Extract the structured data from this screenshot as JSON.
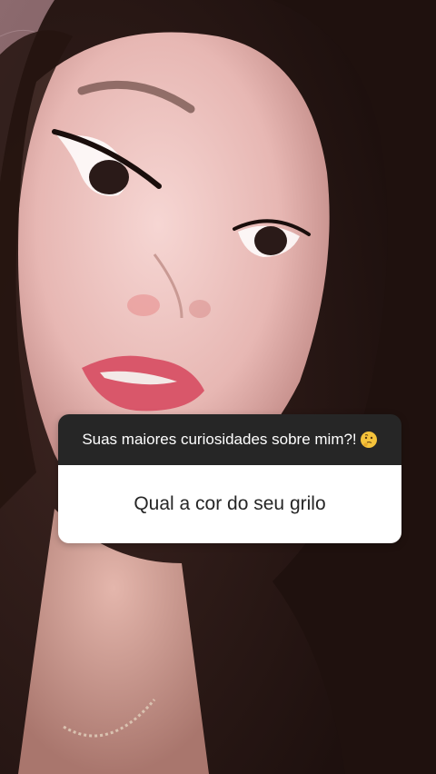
{
  "story": {
    "question_prompt": "Suas maiores curiosidades sobre mim?!",
    "question_emoji": "thinking-face-icon",
    "answer_text": "Qual a cor do seu grilo"
  },
  "colors": {
    "header_bg": "#262626",
    "body_bg": "#ffffff",
    "text_dark": "#262626"
  }
}
